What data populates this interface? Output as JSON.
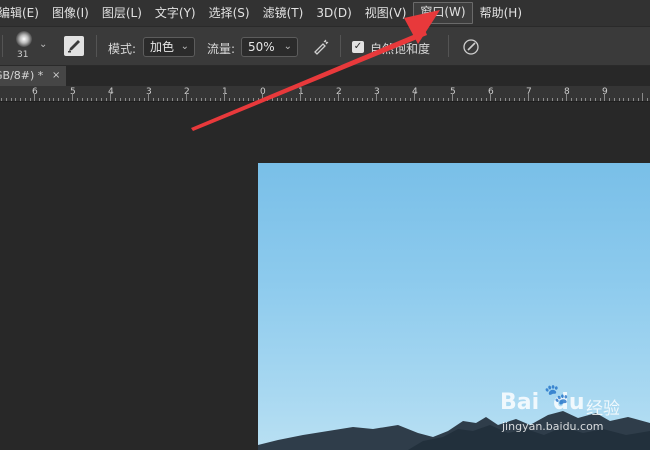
{
  "menu": {
    "items": [
      "编辑(E)",
      "图像(I)",
      "图层(L)",
      "文字(Y)",
      "选择(S)",
      "滤镜(T)",
      "3D(D)",
      "视图(V)",
      "窗口(W)",
      "帮助(H)"
    ],
    "active": "窗口(W)"
  },
  "options": {
    "brush_size": "31",
    "mode_label": "模式:",
    "mode_value": "加色",
    "flow_label": "流量:",
    "flow_value": "50%",
    "vibrance_checked": true,
    "vibrance_label": "自然饱和度"
  },
  "document_tab": {
    "name": "GB/8#) *",
    "close": "×"
  },
  "ruler": {
    "labels": [
      "6",
      "5",
      "4",
      "3",
      "2",
      "1",
      "0",
      "1",
      "2",
      "3",
      "4",
      "5",
      "6",
      "7",
      "8",
      "9"
    ]
  },
  "watermark": {
    "brand": "Bai",
    "brand_suffix": "du",
    "paw": "🐾",
    "cn": "经验",
    "url": "jingyan.baidu.com"
  },
  "colors": {
    "annotation_arrow": "#e8393b",
    "menu_bg": "#323232",
    "options_bg": "#3a3a3a",
    "workspace_bg": "#282828"
  },
  "icons": {
    "airbrush": "brush-pen-icon",
    "pressure": "pen-pressure-icon",
    "symmetry": "brush-angle-icon"
  }
}
